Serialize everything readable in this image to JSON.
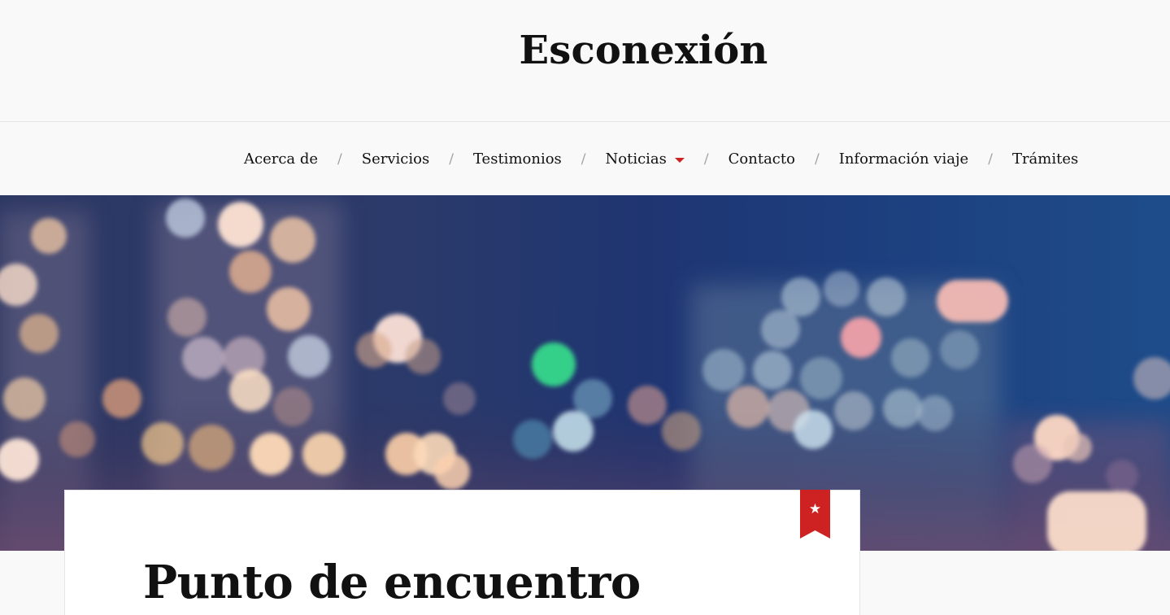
{
  "site": {
    "title": "Esconexión"
  },
  "nav": {
    "items": [
      {
        "label": "Acerca de"
      },
      {
        "label": "Servicios"
      },
      {
        "label": "Testimonios"
      },
      {
        "label": "Noticias",
        "has_dropdown": true
      },
      {
        "label": "Contacto"
      },
      {
        "label": "Información viaje"
      },
      {
        "label": "Trámites"
      }
    ],
    "separator": "/"
  },
  "hero": {
    "image": "blurred city lights bokeh at night"
  },
  "post": {
    "title": "Punto de encuentro",
    "sticky_icon": "star-icon",
    "sticky_glyph": "★"
  },
  "colors": {
    "accent": "#cd2122",
    "background": "#f9f9f9",
    "text": "#111111"
  }
}
